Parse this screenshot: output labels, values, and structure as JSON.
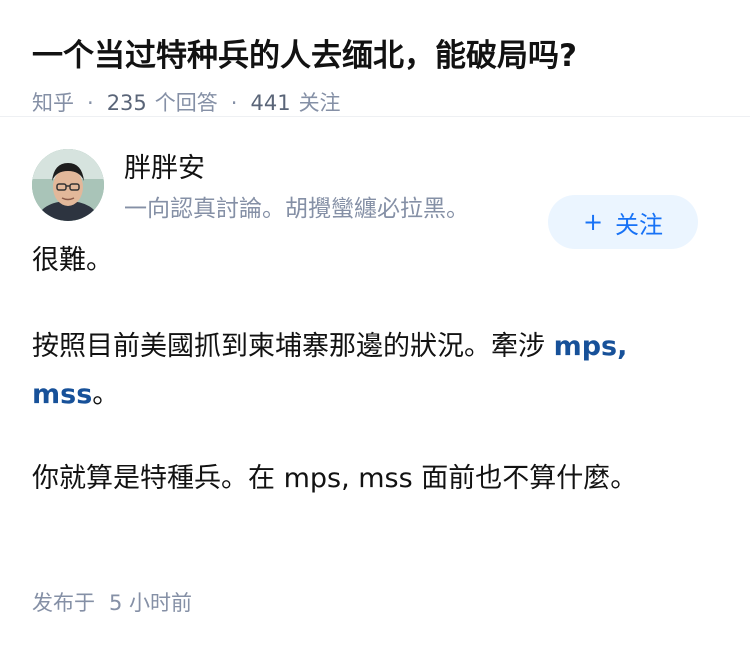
{
  "question": {
    "title": "一个当过特种兵的人去缅北，能破局吗?",
    "source": "知乎",
    "answers_count": "235",
    "answers_label": "个回答",
    "followers_count": "441",
    "followers_label": "关注"
  },
  "author": {
    "name": "胖胖安",
    "bio": "一向認真討論。胡攪蠻纏必拉黑。",
    "follow_label": "关注",
    "follow_icon": "plus-icon"
  },
  "answer": {
    "p1": "很難。",
    "p2_text": "按照目前美國抓到柬埔寨那邊的狀況。牽涉 ",
    "p2_link1": "mps",
    "p2_sep": ", ",
    "p2_link2": "mss",
    "p2_end": "。",
    "p3": "你就算是特種兵。在 mps, mss 面前也不算什麼。"
  },
  "footer": {
    "label": "发布于",
    "time": "5 小时前"
  },
  "colors": {
    "link": "#175199",
    "muted": "#8590a6",
    "follow_bg": "#ebf5ff",
    "follow_text": "#1772f6"
  }
}
